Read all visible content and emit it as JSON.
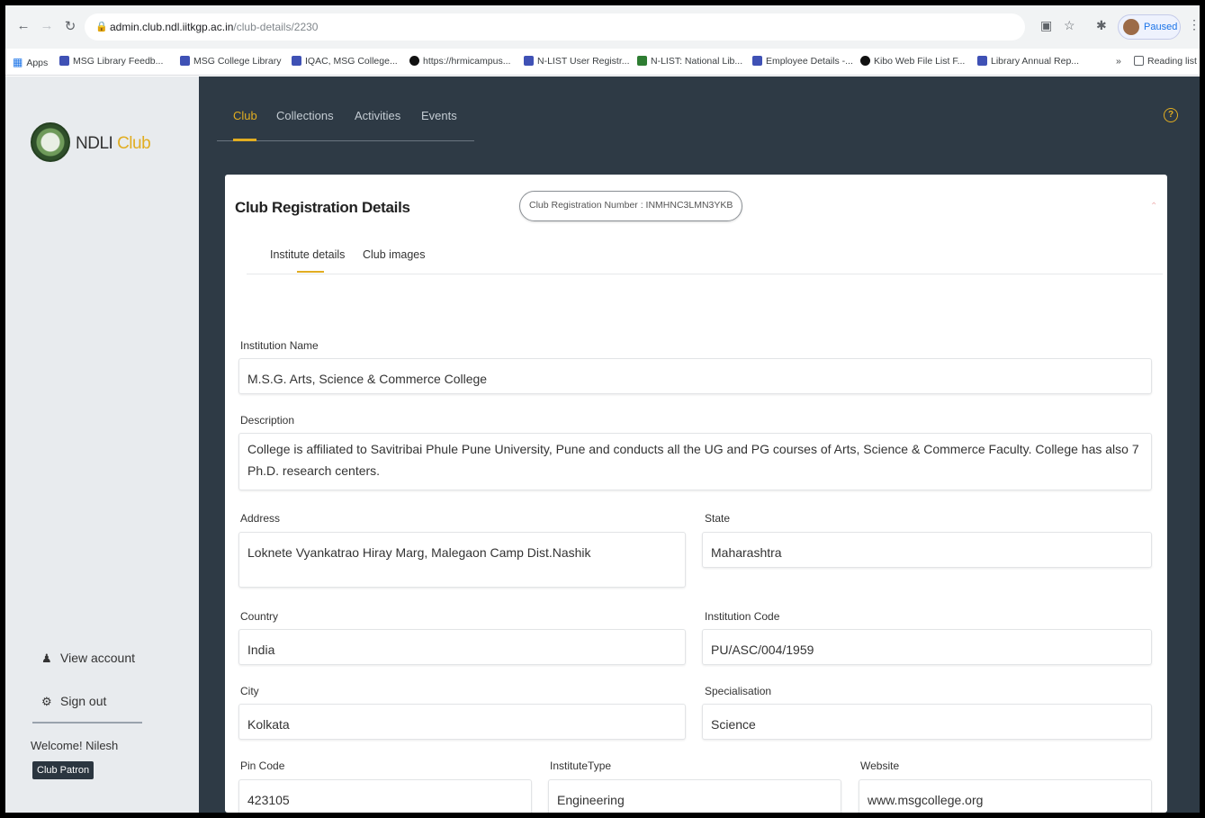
{
  "browser": {
    "url_host": "admin.club.ndl.iitkgp.ac.in",
    "url_path": "/club-details/2230",
    "profile_label": "Paused",
    "bookmarks": [
      {
        "label": "Apps",
        "icon": "apps-icon"
      },
      {
        "label": "MSG Library Feedb...",
        "icon": "form-icon"
      },
      {
        "label": "MSG College Library",
        "icon": "form-icon"
      },
      {
        "label": "IQAC, MSG College...",
        "icon": "form-icon"
      },
      {
        "label": "https://hrmicampus...",
        "icon": "globe-icon"
      },
      {
        "label": "N-LIST User Registr...",
        "icon": "form-icon"
      },
      {
        "label": "N-LIST: National Lib...",
        "icon": "nlist-icon"
      },
      {
        "label": "Employee Details -...",
        "icon": "form-icon"
      },
      {
        "label": "Kibo Web File List F...",
        "icon": "kibo-icon"
      },
      {
        "label": "Library Annual Rep...",
        "icon": "form-icon"
      }
    ],
    "more_bookmarks": "»",
    "reading_list": "Reading list"
  },
  "sidebar": {
    "brand_main": "NDLI",
    "brand_accent": "Club",
    "view_account": "View account",
    "sign_out": "Sign out",
    "welcome": "Welcome! Nilesh",
    "role": "Club Patron"
  },
  "topnav": {
    "tabs": [
      "Club",
      "Collections",
      "Activities",
      "Events"
    ],
    "active": "Club"
  },
  "card": {
    "title": "Club Registration Details",
    "registration_number": "Club Registration Number : INMHNC3LMN3YKB",
    "subtabs": [
      "Institute details",
      "Club images"
    ],
    "active_subtab": "Institute details"
  },
  "form": {
    "institution_name": {
      "label": "Institution Name",
      "value": "M.S.G. Arts, Science & Commerce College"
    },
    "description": {
      "label": "Description",
      "value": "College is affiliated to Savitribai Phule Pune University, Pune and conducts all the UG and PG courses of Arts, Science & Commerce Faculty. College has also 7 Ph.D. research centers."
    },
    "address": {
      "label": "Address",
      "value": "Loknete Vyankatrao Hiray Marg, Malegaon Camp Dist.Nashik"
    },
    "state": {
      "label": "State",
      "value": "Maharashtra"
    },
    "country": {
      "label": "Country",
      "value": "India"
    },
    "institution_code": {
      "label": "Institution Code",
      "value": "PU/ASC/004/1959"
    },
    "city": {
      "label": "City",
      "value": "Kolkata"
    },
    "specialisation": {
      "label": "Specialisation",
      "value": "Science"
    },
    "pin_code": {
      "label": "Pin Code",
      "value": "423105"
    },
    "institute_type": {
      "label": "InstituteType",
      "value": "Engineering"
    },
    "website": {
      "label": "Website",
      "value": "www.msgcollege.org"
    }
  },
  "colors": {
    "accent": "#e1ad21",
    "dark_bg": "#2e3a45",
    "sidebar_bg": "#e8ebee"
  }
}
